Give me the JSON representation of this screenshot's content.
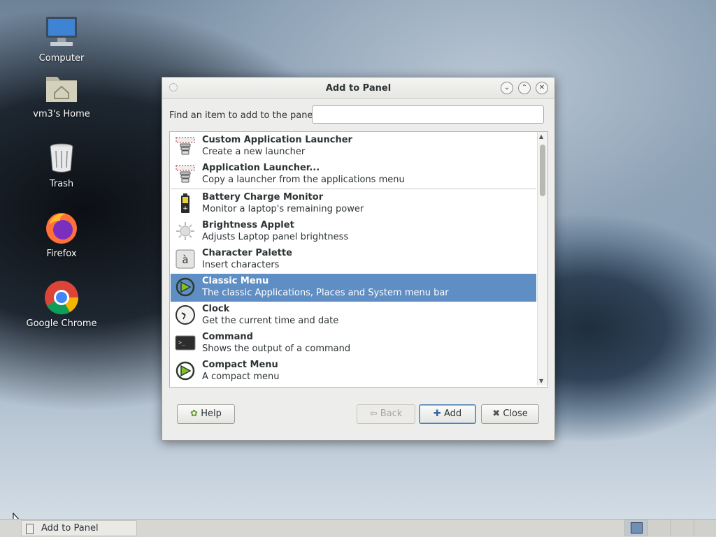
{
  "desktop": {
    "icons": [
      {
        "label": "Computer",
        "icon": "computer-icon"
      },
      {
        "label": "vm3's Home",
        "icon": "home-folder-icon"
      },
      {
        "label": "Trash",
        "icon": "trash-icon"
      },
      {
        "label": "Firefox",
        "icon": "firefox-icon"
      },
      {
        "label": "Google Chrome",
        "icon": "chrome-icon"
      }
    ]
  },
  "dialog": {
    "title": "Add to Panel",
    "find_label": "Find an item to add to the panel:",
    "search_value": "",
    "items": [
      {
        "name": "Custom Application Launcher",
        "desc": "Create a new launcher",
        "icon": "launcher-icon"
      },
      {
        "name": "Application Launcher...",
        "desc": "Copy a launcher from the applications menu",
        "icon": "launcher-icon"
      },
      {
        "name": "Battery Charge Monitor",
        "desc": "Monitor a laptop's remaining power",
        "icon": "battery-icon"
      },
      {
        "name": "Brightness Applet",
        "desc": "Adjusts Laptop panel brightness",
        "icon": "brightness-icon"
      },
      {
        "name": "Character Palette",
        "desc": "Insert characters",
        "icon": "character-palette-icon",
        "glyph": "à"
      },
      {
        "name": "Classic Menu",
        "desc": "The classic Applications, Places and System menu bar",
        "icon": "menu-icon",
        "selected": true
      },
      {
        "name": "Clock",
        "desc": "Get the current time and date",
        "icon": "clock-icon"
      },
      {
        "name": "Command",
        "desc": "Shows the output of a command",
        "icon": "terminal-icon"
      },
      {
        "name": "Compact Menu",
        "desc": "A compact menu",
        "icon": "menu-icon"
      }
    ],
    "buttons": {
      "help": "Help",
      "back": "Back",
      "add": "Add",
      "close": "Close"
    },
    "colors": {
      "selection": "#5f8ec4"
    }
  },
  "taskbar": {
    "task_label": "Add to Panel"
  }
}
